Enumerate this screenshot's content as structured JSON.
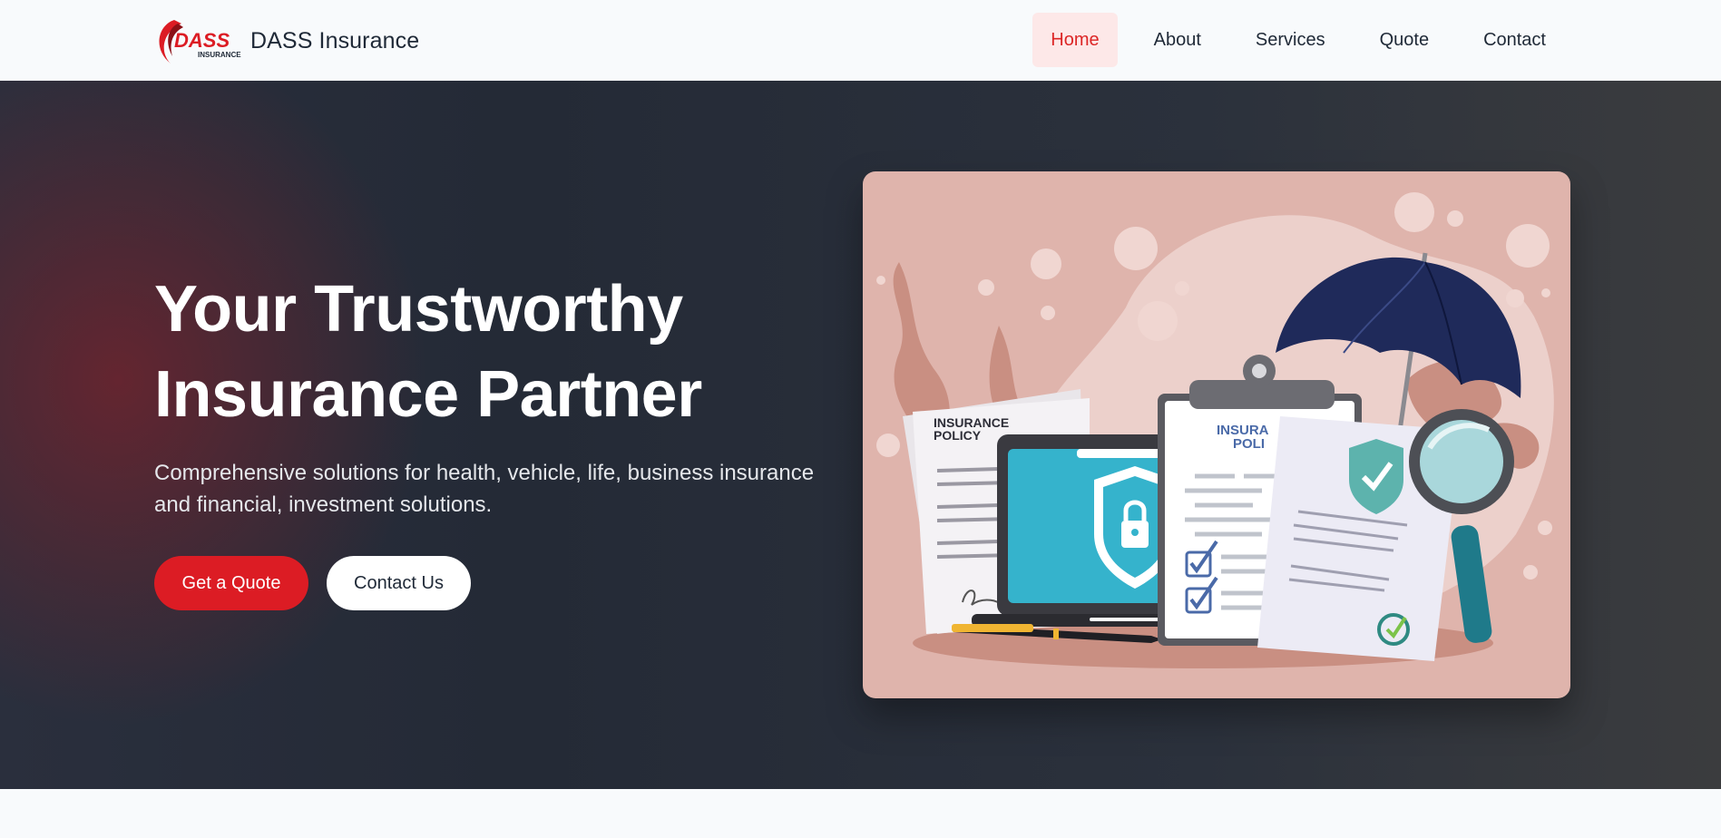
{
  "brand": {
    "name": "DASS Insurance",
    "logo_word": "DASS",
    "logo_sub": "INSURANCE",
    "accent": "#dc1c24"
  },
  "nav": {
    "items": [
      {
        "label": "Home",
        "active": true
      },
      {
        "label": "About",
        "active": false
      },
      {
        "label": "Services",
        "active": false
      },
      {
        "label": "Quote",
        "active": false
      },
      {
        "label": "Contact",
        "active": false
      }
    ]
  },
  "hero": {
    "title_line1": "Your Trustworthy",
    "title_line2": "Insurance Partner",
    "subtitle": "Comprehensive solutions for health, vehicle, life, business insurance and financial, investment solutions.",
    "primary_button": "Get a Quote",
    "secondary_button": "Contact Us"
  },
  "illustration": {
    "doc_left_title_1": "INSURANCE",
    "doc_left_title_2": "POLICY",
    "clipboard_title_1": "INSURA",
    "clipboard_title_2": "POLI",
    "colors": {
      "card_bg": "#dfb4ac",
      "umbrella": "#1f2a5a",
      "laptop_screen": "#35b3cc",
      "shield": "#5db3ad"
    }
  }
}
